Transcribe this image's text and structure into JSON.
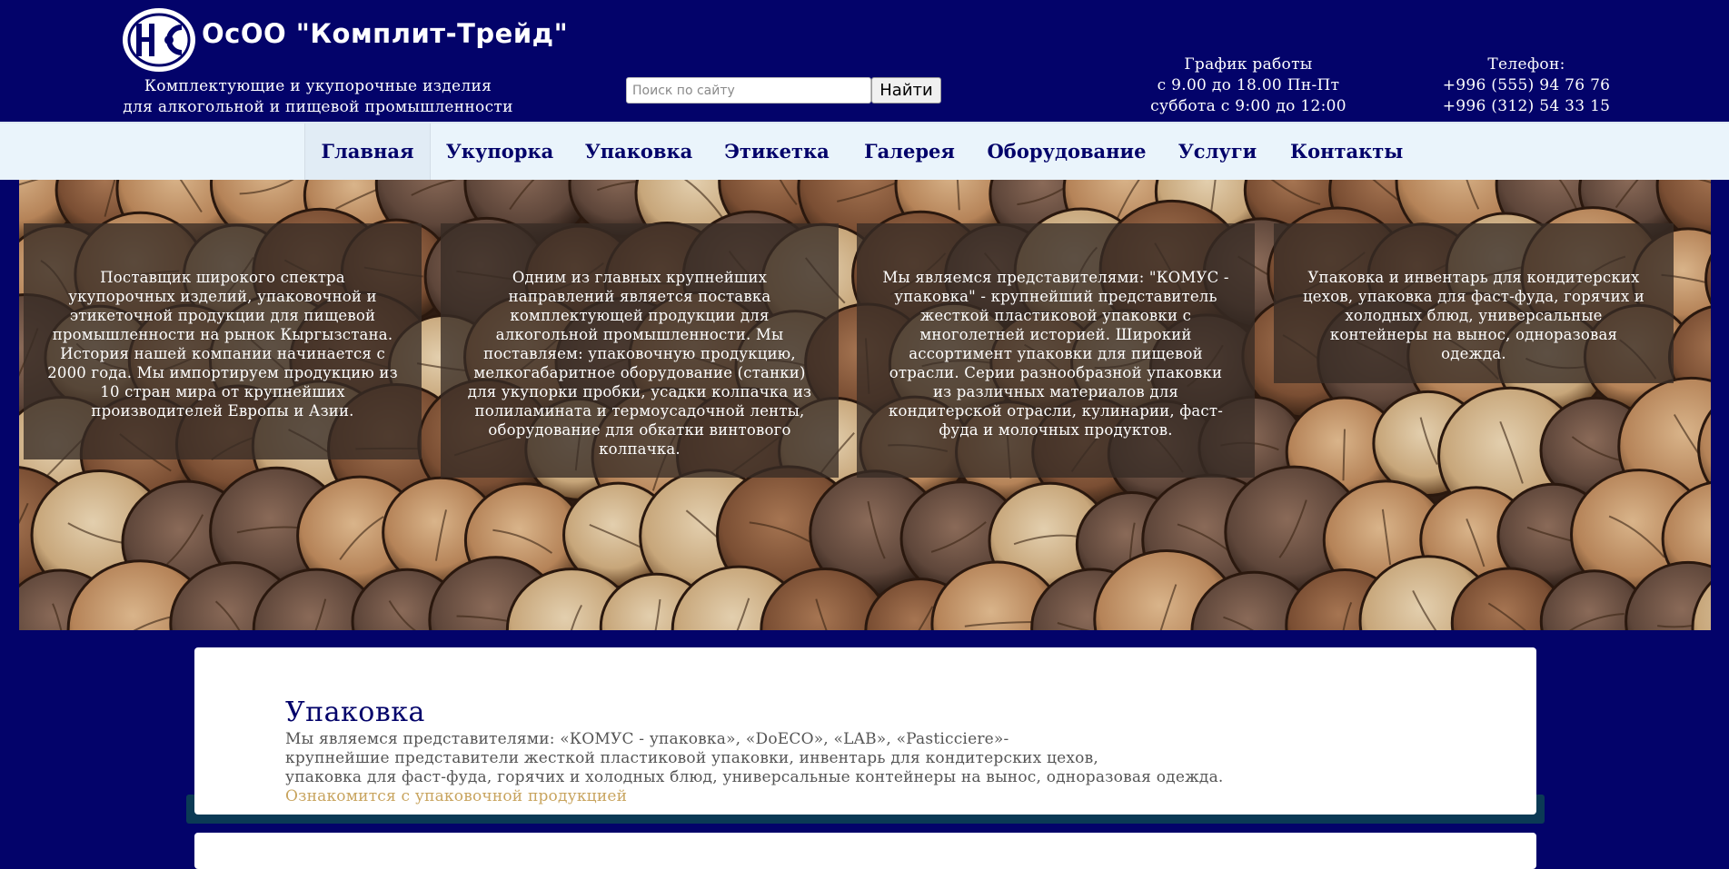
{
  "header": {
    "logo_text": "КТ",
    "company_name": "ОсОО \"Комплит-Трейд\"",
    "tagline_line1": "Комплектующие и укупорочные изделия",
    "tagline_line2": "для алкогольной и пищевой промышленности",
    "search": {
      "placeholder": "Поиск по сайту",
      "button_label": "Найти"
    },
    "schedule": {
      "title": "График работы",
      "line1": "с 9.00 до 18.00 Пн-Пт",
      "line2": "суббота с 9:00 до 12:00"
    },
    "phone": {
      "title": "Телефон:",
      "line1": "+996 (555) 94 76 76",
      "line2": "+996 (312) 54 33 15"
    }
  },
  "nav": {
    "items": [
      {
        "label": "Главная",
        "active": true
      },
      {
        "label": "Укупорка"
      },
      {
        "label": "Упаковка"
      },
      {
        "label": "Этикетка"
      },
      {
        "label": "Галерея"
      },
      {
        "label": "Оборудование"
      },
      {
        "label": "Услуги"
      },
      {
        "label": "Контакты"
      }
    ]
  },
  "hero": {
    "boxes": [
      {
        "text": "Поставщик широкого спектра укупорочных изделий, упаковочной и этикеточной продукции для пищевой промышленности на рынок Кыргызстана. История нашей компании начинается с 2000 года. Мы импортируем продукцию из 10 стран мира от крупнейших производителей Европы и Азии."
      },
      {
        "text": "Одним из главных крупнейших направлений является поставка комплектующей продукции для алкогольной промышленности. Мы поставляем: упаковочную продукцию, мелкогабаритное оборудование (станки) для укупорки пробки, усадки колпачка из полиламината и термоусадочной ленты, оборудование для обкатки винтового колпачка."
      },
      {
        "text": "Мы являемся представителями: \"КОМУС - упаковка\" - крупнейший представитель жесткой пластиковой упаковки с многолетней историей. Широкий ассортимент упаковки для пищевой отрасли. Серии разнообразной упаковки из различных материалов для кондитерской отрасли, кулинарии, фаст-фуда и молочных продуктов."
      },
      {
        "text": "Упаковка и инвентарь для кондитерских цехов, упаковка для фаст-фуда, горячих и холодных блюд, универсальные контейнеры на вынос, одноразовая одежда."
      }
    ]
  },
  "section": {
    "title": "Упаковка",
    "line1": "Мы являемся представителями: «КОМУС - упаковка», «DoECO», «LAB», «Pasticciere»-",
    "line2": "крупнейшие представители жесткой пластиковой упаковки, инвентарь для кондитерских цехов,",
    "line3": "упаковка для фаст-фуда, горячих и холодных блюд, универсальные контейнеры на вынос, одноразовая одежда.",
    "link": "Ознакомится с упаковочной продукцией"
  },
  "colors": {
    "header_bg": "#03036a",
    "nav_bg": "#eaf4fb",
    "accent_link": "#c8a45e"
  }
}
